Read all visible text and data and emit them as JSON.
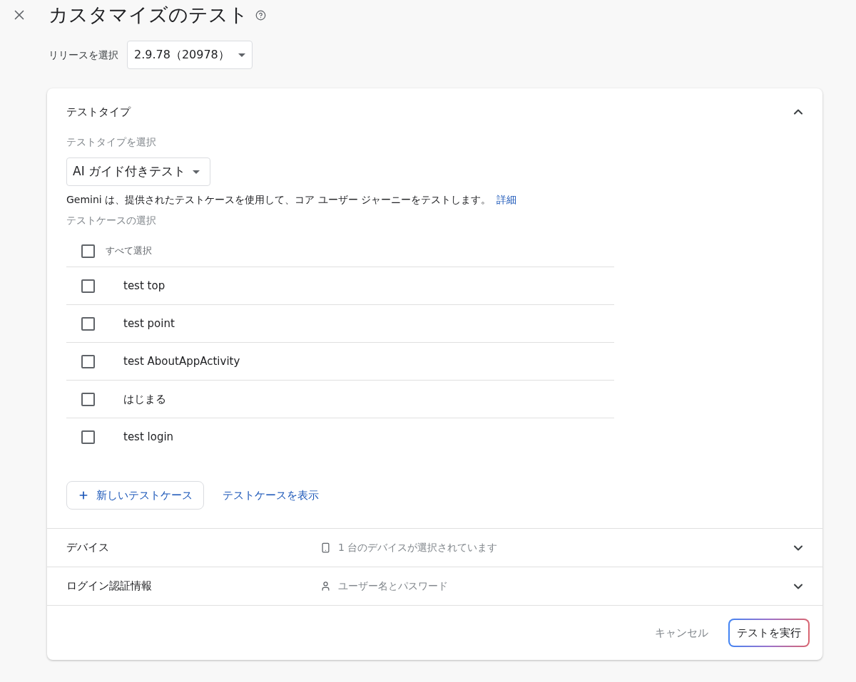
{
  "header": {
    "title": "カスタマイズのテスト"
  },
  "release": {
    "label": "リリースを選択",
    "value": "2.9.78（20978）"
  },
  "sections": [
    {
      "kind": "test_type",
      "title": "テストタイプ",
      "expanded": true,
      "type_label": "テストタイプを選択",
      "type_value": "AI ガイド付きテスト",
      "description": "Gemini は、提供されたテストケースを使用して、コア ユーザー ジャーニーをテストします。",
      "link": "詳細",
      "cases_label": "テストケースの選択",
      "select_all": {
        "label": "すべて選択",
        "checked": false
      },
      "cases": [
        {
          "label": "test top",
          "checked": false
        },
        {
          "label": "test point",
          "checked": false
        },
        {
          "label": "test AboutAppActivity",
          "checked": false
        },
        {
          "label": "はじまる",
          "checked": false
        },
        {
          "label": "test login",
          "checked": false
        }
      ],
      "new_button": "新しいテストケース",
      "view_link": "テストケースを表示"
    },
    {
      "kind": "device",
      "title": "デバイス",
      "expanded": false,
      "summary": "1 台のデバイスが選択されています"
    },
    {
      "kind": "login",
      "title": "ログイン認証情報",
      "expanded": false,
      "summary": "ユーザー名とパスワード"
    }
  ],
  "footer": {
    "cancel": "キャンセル",
    "run": "テストを実行"
  }
}
